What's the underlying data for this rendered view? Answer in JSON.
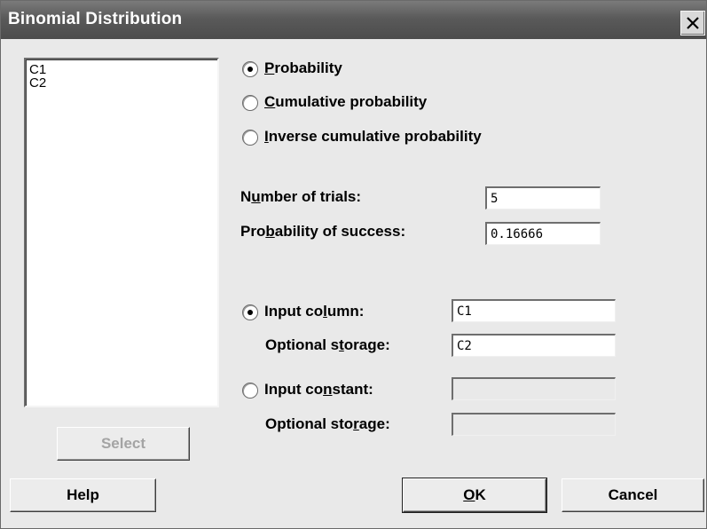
{
  "window": {
    "title": "Binomial Distribution"
  },
  "variables_list": {
    "items": [
      "C1",
      "C2"
    ]
  },
  "select_button": {
    "label": "Select"
  },
  "mode": {
    "selected": "Probability",
    "options": [
      {
        "u": "P",
        "rest": "robability"
      },
      {
        "u": "C",
        "rest": "umulative probability"
      },
      {
        "u": "I",
        "rest": "nverse cumulative probability"
      }
    ]
  },
  "params": {
    "trials_label": {
      "a": "N",
      "u": "u",
      "b": "mber of trials:"
    },
    "trials_value": "5",
    "success_label": {
      "a": "Pro",
      "u": "b",
      "b": "ability of success:"
    },
    "success_value": "0.16666"
  },
  "input_source": {
    "selected": "Input column",
    "column_label": {
      "a": "Input co",
      "u": "l",
      "b": "umn:"
    },
    "column_value": "C1",
    "column_storage_label": {
      "a": "Optional s",
      "u": "t",
      "b": "orage:"
    },
    "column_storage_value": "C2",
    "constant_label": {
      "a": "Input co",
      "u": "n",
      "b": "stant:"
    },
    "constant_value": "",
    "constant_storage_label": {
      "a": "Optional sto",
      "u": "r",
      "b": "age:"
    },
    "constant_storage_value": ""
  },
  "buttons": {
    "help": "Help",
    "ok": {
      "u": "O",
      "rest": "K"
    },
    "cancel": "Cancel"
  }
}
